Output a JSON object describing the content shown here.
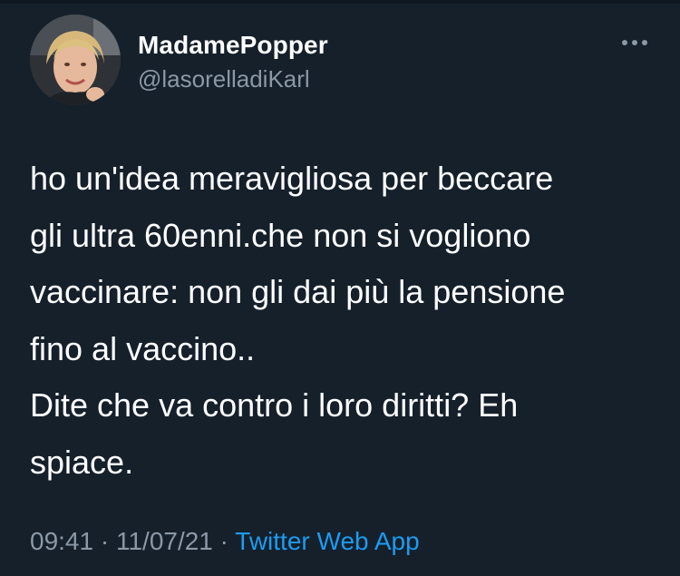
{
  "user": {
    "display_name": "MadamePopper",
    "handle": "@lasorelladiKarl"
  },
  "tweet": {
    "lines": [
      "ho un'idea meravigliosa per beccare",
      "gli ultra 60enni.che non si vogliono",
      "vaccinare: non gli dai più la pensione",
      "fino al vaccino..",
      "Dite che va contro i loro diritti? Eh",
      "spiace."
    ],
    "time": "09:41",
    "separator": " · ",
    "date": "11/07/21",
    "source": "Twitter Web App"
  },
  "icons": {
    "more": "more-options-icon",
    "avatar": "avatar"
  },
  "colors": {
    "background": "#15202b",
    "primary_text": "#ffffff",
    "secondary_text": "#8b98a5",
    "link": "#1d9bf0"
  }
}
